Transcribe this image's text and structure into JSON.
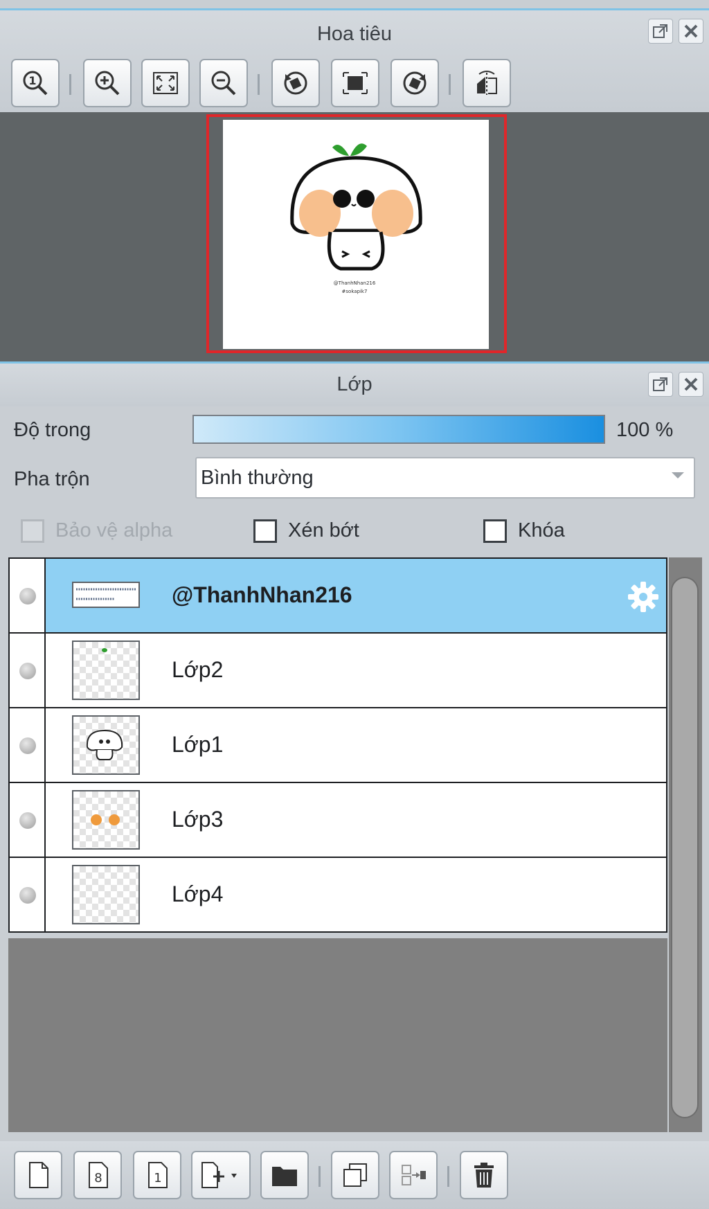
{
  "navigator": {
    "title": "Hoa tiêu",
    "canvas_text_line1": "@ThanhNhan216",
    "canvas_text_line2": "#sokapik7"
  },
  "layers_panel": {
    "title": "Lớp",
    "opacity_label": "Độ trong",
    "opacity_value": "100 %",
    "opacity_fraction": 1.0,
    "blend_label": "Pha trộn",
    "blend_value": "Bình thường",
    "protect_alpha_label": "Bảo vệ alpha",
    "clipping_label": "Xén bớt",
    "lock_label": "Khóa",
    "layers": [
      {
        "name": "@ThanhNhan216",
        "selected": true
      },
      {
        "name": "Lớp2",
        "selected": false
      },
      {
        "name": "Lớp1",
        "selected": false
      },
      {
        "name": "Lớp3",
        "selected": false
      },
      {
        "name": "Lớp4",
        "selected": false
      }
    ]
  },
  "colors": {
    "accent": "#8fd0f3",
    "viewport_border": "#e0262a"
  }
}
